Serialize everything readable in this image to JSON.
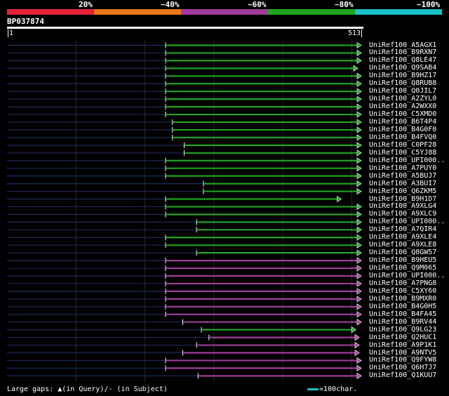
{
  "percent_labels": [
    "20%",
    "~40%",
    "~60%",
    "~80%",
    "~100%"
  ],
  "color_bands": [
    {
      "name": "under-20",
      "color": "#e8203a"
    },
    {
      "name": "20-40",
      "color": "#e87818"
    },
    {
      "name": "40-60",
      "color": "#a03c9c"
    },
    {
      "name": "60-80",
      "color": "#20a420"
    },
    {
      "name": "80-100",
      "color": "#19c0c8"
    }
  ],
  "query": {
    "name": "BP037874",
    "start_label": "1",
    "end_label": "513",
    "length": 513
  },
  "hits": [
    {
      "name": "UniRef100_A5AGX1",
      "start": 230,
      "end": 513,
      "color": "#20a420"
    },
    {
      "name": "UniRef100_B9RXN7",
      "start": 230,
      "end": 513,
      "color": "#20a420"
    },
    {
      "name": "UniRef100_Q8LE47",
      "start": 230,
      "end": 513,
      "color": "#20a420"
    },
    {
      "name": "UniRef100_Q9SAB4",
      "start": 230,
      "end": 508,
      "color": "#20a420"
    },
    {
      "name": "UniRef100_B9HZ17",
      "start": 230,
      "end": 513,
      "color": "#20a420"
    },
    {
      "name": "UniRef100_Q8RUB8",
      "start": 230,
      "end": 513,
      "color": "#20a420"
    },
    {
      "name": "UniRef100_Q0JIL7",
      "start": 230,
      "end": 513,
      "color": "#20a420"
    },
    {
      "name": "UniRef100_A2ZYL0",
      "start": 230,
      "end": 513,
      "color": "#20a420"
    },
    {
      "name": "UniRef100_A2WXX0",
      "start": 230,
      "end": 513,
      "color": "#20a420"
    },
    {
      "name": "UniRef100_C5XMD0",
      "start": 230,
      "end": 513,
      "color": "#20a420"
    },
    {
      "name": "UniRef100_B6T4P4",
      "start": 240,
      "end": 513,
      "color": "#20a420"
    },
    {
      "name": "UniRef100_B4G0F0",
      "start": 240,
      "end": 513,
      "color": "#20a420"
    },
    {
      "name": "UniRef100_B4FVQ0",
      "start": 240,
      "end": 513,
      "color": "#20a420"
    },
    {
      "name": "UniRef100_C0PF28",
      "start": 257,
      "end": 513,
      "color": "#20a420"
    },
    {
      "name": "UniRef100_C5YJ88",
      "start": 257,
      "end": 513,
      "color": "#20a420"
    },
    {
      "name": "UniRef100_UPI000..",
      "start": 230,
      "end": 513,
      "color": "#20a420"
    },
    {
      "name": "UniRef100_A7PUY0",
      "start": 230,
      "end": 513,
      "color": "#20a420"
    },
    {
      "name": "UniRef100_A5BUJ7",
      "start": 230,
      "end": 513,
      "color": "#20a420"
    },
    {
      "name": "UniRef100_A3BUI7",
      "start": 285,
      "end": 513,
      "color": "#20a420"
    },
    {
      "name": "UniRef100_Q6ZKM5",
      "start": 285,
      "end": 513,
      "color": "#20a420"
    },
    {
      "name": "UniRef100_B9H1D7",
      "start": 230,
      "end": 484,
      "color": "#20a420"
    },
    {
      "name": "UniRef100_A9XLG4",
      "start": 230,
      "end": 513,
      "color": "#20a420"
    },
    {
      "name": "UniRef100_A9XLC9",
      "start": 230,
      "end": 513,
      "color": "#20a420"
    },
    {
      "name": "UniRef100_UPI000..",
      "start": 275,
      "end": 513,
      "color": "#20a420"
    },
    {
      "name": "UniRef100_A7QIR4",
      "start": 275,
      "end": 513,
      "color": "#20a420"
    },
    {
      "name": "UniRef100_A9XLE4",
      "start": 230,
      "end": 513,
      "color": "#20a420"
    },
    {
      "name": "UniRef100_A9XLE8",
      "start": 230,
      "end": 513,
      "color": "#20a420"
    },
    {
      "name": "UniRef100_Q8GW57",
      "start": 275,
      "end": 513,
      "color": "#20a420"
    },
    {
      "name": "UniRef100_B9HEU5",
      "start": 230,
      "end": 513,
      "color": "#a03c9c"
    },
    {
      "name": "UniRef100_Q9M065",
      "start": 230,
      "end": 513,
      "color": "#a03c9c"
    },
    {
      "name": "UniRef100_UPI000..",
      "start": 230,
      "end": 513,
      "color": "#a03c9c"
    },
    {
      "name": "UniRef100_A7PNG8",
      "start": 230,
      "end": 513,
      "color": "#a03c9c"
    },
    {
      "name": "UniRef100_C5XY60",
      "start": 230,
      "end": 513,
      "color": "#a03c9c"
    },
    {
      "name": "UniRef100_B9MXR0",
      "start": 230,
      "end": 513,
      "color": "#a03c9c"
    },
    {
      "name": "UniRef100_B4G0H5",
      "start": 230,
      "end": 513,
      "color": "#a03c9c"
    },
    {
      "name": "UniRef100_B4FA45",
      "start": 230,
      "end": 513,
      "color": "#a03c9c"
    },
    {
      "name": "UniRef100_B9RV44",
      "start": 255,
      "end": 513,
      "color": "#a03c9c"
    },
    {
      "name": "UniRef100_Q9LG23",
      "start": 282,
      "end": 505,
      "color": "#20a420"
    },
    {
      "name": "UniRef100_Q2HUC1",
      "start": 293,
      "end": 510,
      "color": "#a03c9c"
    },
    {
      "name": "UniRef100_A9P1K1",
      "start": 275,
      "end": 510,
      "color": "#a03c9c"
    },
    {
      "name": "UniRef100_A9NTV5",
      "start": 255,
      "end": 510,
      "color": "#a03c9c"
    },
    {
      "name": "UniRef100_Q9FYW8",
      "start": 230,
      "end": 513,
      "color": "#a03c9c"
    },
    {
      "name": "UniRef100_Q6H7J7",
      "start": 230,
      "end": 513,
      "color": "#a03c9c"
    },
    {
      "name": "UniRef100_Q1KUU7",
      "start": 277,
      "end": 513,
      "color": "#a03c9c"
    }
  ],
  "footer": {
    "legend": "Large gaps: ▲(in Query)/- (in Subject)",
    "scale": "=100char."
  }
}
